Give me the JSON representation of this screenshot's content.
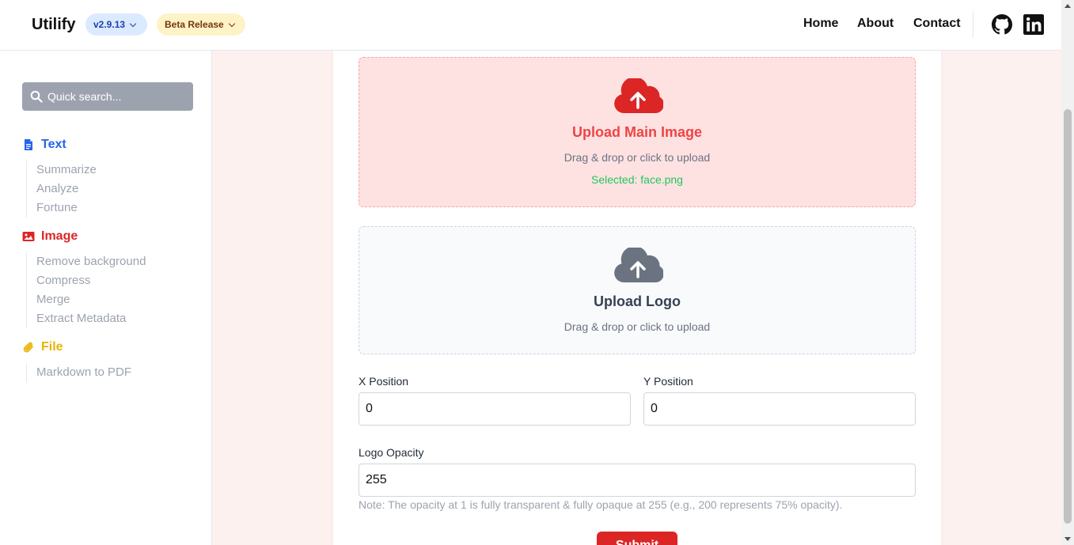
{
  "header": {
    "brand": "Utilify",
    "version_badge": "v2.9.13",
    "beta_badge": "Beta Release",
    "nav": [
      "Home",
      "About",
      "Contact"
    ],
    "icons": [
      "github-icon",
      "linkedin-icon"
    ]
  },
  "sidebar": {
    "search_placeholder": "Quick search...",
    "sections": [
      {
        "label": "Text",
        "color": "#2563eb",
        "icon": "document-icon",
        "items": [
          "Summarize",
          "Analyze",
          "Fortune"
        ]
      },
      {
        "label": "Image",
        "color": "#dc2626",
        "icon": "image-icon",
        "items": [
          "Remove background",
          "Compress",
          "Merge",
          "Extract Metadata"
        ]
      },
      {
        "label": "File",
        "color": "#eab308",
        "icon": "paperclip-icon",
        "items": [
          "Markdown to PDF"
        ]
      }
    ]
  },
  "form": {
    "main_upload": {
      "title": "Upload Main Image",
      "hint": "Drag & drop or click to upload",
      "selected": "Selected: face.png",
      "color": "#ef4444"
    },
    "logo_upload": {
      "title": "Upload Logo",
      "hint": "Drag & drop or click to upload",
      "color": "#6b7280"
    },
    "x_label": "X Position",
    "x_value": "0",
    "y_label": "Y Position",
    "y_value": "0",
    "opacity_label": "Logo Opacity",
    "opacity_value": "255",
    "note": "Note: The opacity at 1 is fully transparent & fully opaque at 255 (e.g., 200 represents 75% opacity).",
    "submit": "Submit"
  }
}
